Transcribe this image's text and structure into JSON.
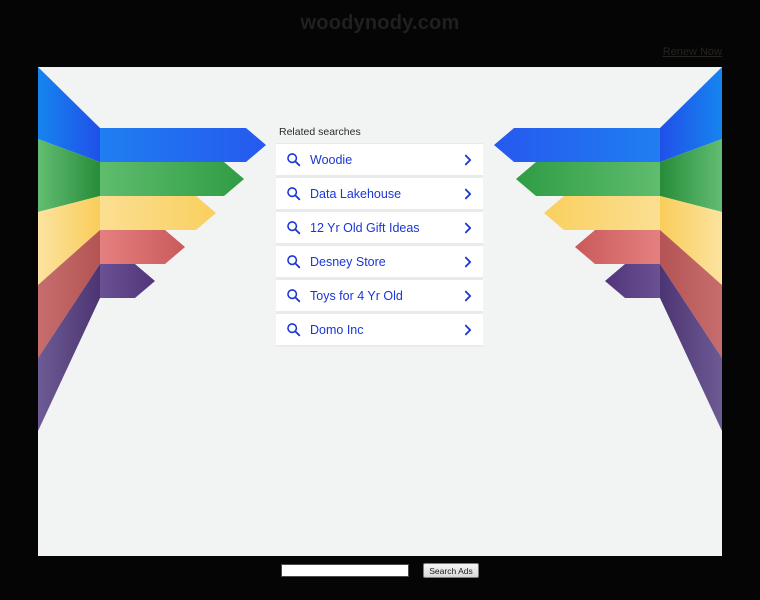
{
  "page": {
    "title": "woodynody.com",
    "background_color": "#050505",
    "stage_color": "#f2f3f3"
  },
  "header": {
    "renew_label": "Renew Now"
  },
  "related": {
    "heading": "Related searches",
    "items": [
      {
        "label": "Woodie",
        "search_icon": "search-icon",
        "chevron_icon": "chevron-right-icon"
      },
      {
        "label": "Data Lakehouse",
        "search_icon": "search-icon",
        "chevron_icon": "chevron-right-icon"
      },
      {
        "label": "12 Yr Old Gift Ideas",
        "search_icon": "search-icon",
        "chevron_icon": "chevron-right-icon"
      },
      {
        "label": "Desney Store",
        "search_icon": "search-icon",
        "chevron_icon": "chevron-right-icon"
      },
      {
        "label": "Toys for 4 Yr Old",
        "search_icon": "search-icon",
        "chevron_icon": "chevron-right-icon"
      },
      {
        "label": "Domo Inc",
        "search_icon": "search-icon",
        "chevron_icon": "chevron-right-icon"
      }
    ],
    "link_color": "#1a36d8"
  },
  "graphic": {
    "name": "rainbow-arrow-ribbons",
    "band_colors": [
      "#1a73e8",
      "#4fa85a",
      "#fad87a",
      "#df7272",
      "#5d4488"
    ],
    "band_shade_colors": [
      "#1f5fd8",
      "#2f8f43",
      "#f7cb5e",
      "#c25b5b",
      "#4b3470"
    ],
    "band_count": 5
  },
  "footer": {
    "search_value": "",
    "search_placeholder": "",
    "search_button_label": "Search Ads"
  }
}
